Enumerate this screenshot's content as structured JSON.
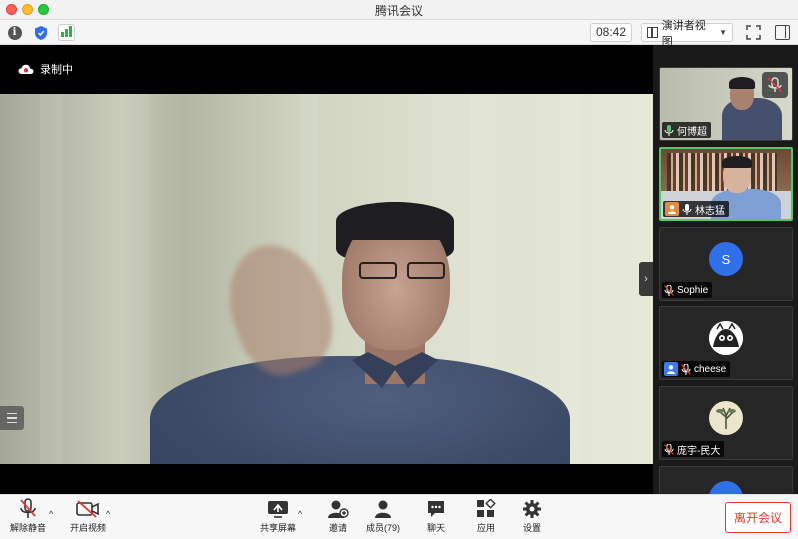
{
  "window": {
    "title": "腾讯会议"
  },
  "toolbar": {
    "clock": "08:42",
    "view_mode": "演讲者视图"
  },
  "stage": {
    "recording_label": "录制中"
  },
  "participants": [
    {
      "name": "何博超",
      "mic": "on",
      "video": "on"
    },
    {
      "name": "林志猛",
      "mic": "on",
      "video": "on",
      "active": true,
      "host": true
    },
    {
      "name": "Sophie",
      "mic": "muted",
      "video": "off",
      "avatar_letter": "S"
    },
    {
      "name": "cheese",
      "mic": "muted",
      "video": "off",
      "cohost": true
    },
    {
      "name": "庞宇-民大",
      "mic": "muted",
      "video": "off"
    }
  ],
  "controls": {
    "unmute": "解除静音",
    "start_video": "开启视频",
    "share_screen": "共享屏幕",
    "invite": "邀请",
    "members": "成员(79)",
    "chat": "聊天",
    "apps": "应用",
    "settings": "设置",
    "leave": "离开会议"
  },
  "colors": {
    "leave_red": "#e03a2f",
    "active_green": "#57c46a",
    "avatar_blue": "#2f6fe8"
  }
}
